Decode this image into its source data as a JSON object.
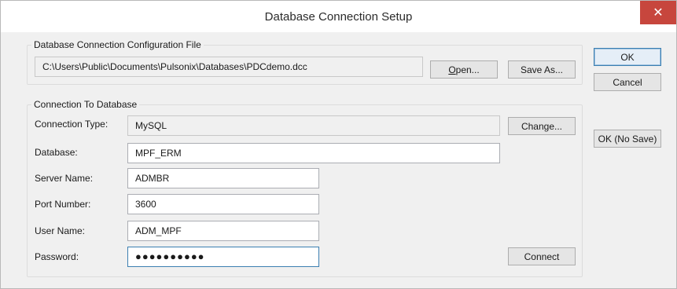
{
  "window": {
    "title": "Database Connection Setup",
    "close_glyph": "✕",
    "accent_close": "#c7463d"
  },
  "config_file": {
    "caption": "Database Connection Configuration File",
    "path": "C:\\Users\\Public\\Documents\\Pulsonix\\Databases\\PDCdemo.dcc",
    "open_first_letter": "O",
    "open_rest": "pen...",
    "save_as_label": "Save As..."
  },
  "side_buttons": {
    "ok_label": "OK",
    "cancel_label": "Cancel",
    "ok_no_save_label": "OK (No Save)"
  },
  "connection": {
    "caption": "Connection To Database",
    "connection_type_label": "Connection Type:",
    "connection_type_value": "MySQL",
    "change_label": "Change...",
    "database_label": "Database:",
    "database_value": "MPF_ERM",
    "server_name_label": "Server Name:",
    "server_name_value": "ADMBR",
    "port_number_label": "Port Number:",
    "port_number_value": "3600",
    "user_name_label": "User Name:",
    "user_name_value": "ADM_MPF",
    "password_label": "Password:",
    "password_value": "●●●●●●●●●●",
    "connect_label": "Connect"
  },
  "icons": {
    "close": "close-icon"
  }
}
